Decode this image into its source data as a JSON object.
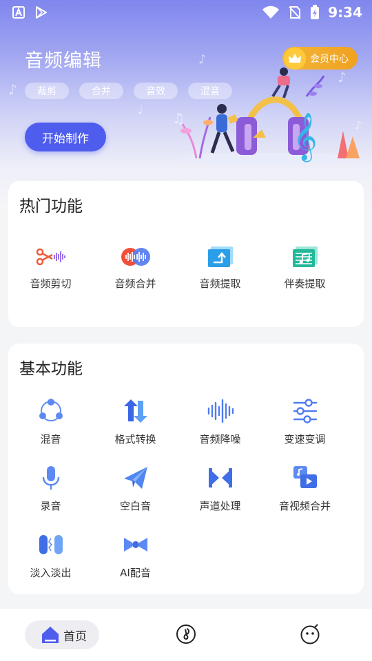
{
  "status": {
    "time": "9:34"
  },
  "header": {
    "title": "音频编辑",
    "member_label": "会员中心",
    "tags": [
      "裁剪",
      "合并",
      "音效",
      "混音"
    ],
    "start_label": "开始制作"
  },
  "hot": {
    "title": "热门功能",
    "items": [
      {
        "label": "音频剪切",
        "icon": "scissors-wave-icon"
      },
      {
        "label": "音频合并",
        "icon": "merge-wave-icon"
      },
      {
        "label": "音频提取",
        "icon": "extract-icon"
      },
      {
        "label": "伴奏提取",
        "icon": "sheet-music-icon"
      }
    ]
  },
  "basic": {
    "title": "基本功能",
    "items": [
      {
        "label": "混音",
        "icon": "mix-icon"
      },
      {
        "label": "格式转换",
        "icon": "convert-arrows-icon"
      },
      {
        "label": "音频降噪",
        "icon": "waveform-icon"
      },
      {
        "label": "变速变调",
        "icon": "sliders-icon"
      },
      {
        "label": "录音",
        "icon": "microphone-icon"
      },
      {
        "label": "空白音",
        "icon": "paper-plane-icon"
      },
      {
        "label": "声道处理",
        "icon": "channel-icon"
      },
      {
        "label": "音视频合并",
        "icon": "av-merge-icon"
      },
      {
        "label": "淡入淡出",
        "icon": "fade-icon"
      },
      {
        "label": "AI配音",
        "icon": "ai-dub-icon"
      }
    ]
  },
  "nav": {
    "home_label": "首页",
    "items": [
      "home-icon",
      "music-note-icon",
      "profile-face-icon"
    ]
  },
  "colors": {
    "accent": "#4e5ded",
    "gold": "#f0a21f"
  }
}
